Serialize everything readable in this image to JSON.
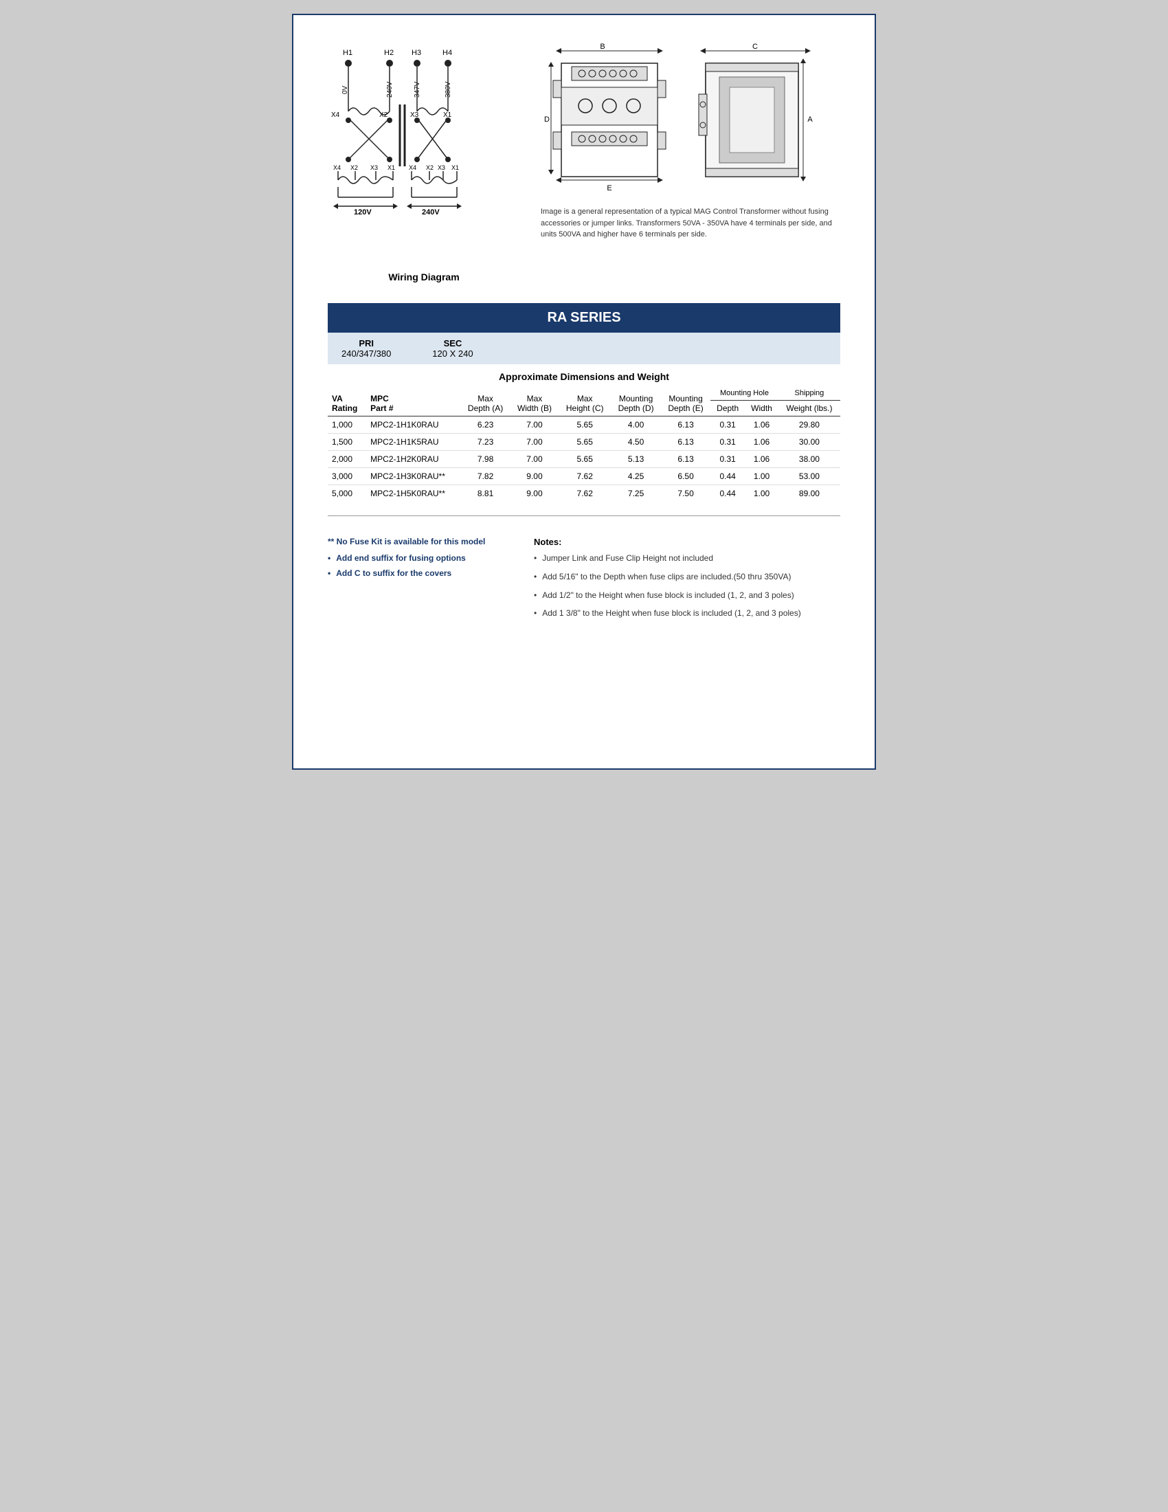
{
  "wiring": {
    "label": "Wiring Diagram",
    "terminals_h": [
      "H1",
      "H2",
      "H3",
      "H4"
    ],
    "voltages_h": [
      "0V",
      "240V",
      "347V",
      "380V"
    ],
    "terminals_x": [
      "X4",
      "X2",
      "X3",
      "X1"
    ],
    "secondary_voltages": [
      "120V",
      "240V"
    ]
  },
  "transformer": {
    "caption": "Image is a general representation of a typical MAG Control Transformer without fusing accessories or jumper links.  Transformers 50VA - 350VA  have 4 terminals per side, and units 500VA and higher have 6 terminals per side."
  },
  "series": {
    "title": "RA SERIES",
    "pri_label": "PRI",
    "pri_value": "240/347/380",
    "sec_label": "SEC",
    "sec_value": "120 X 240",
    "dimensions_title": "Approximate Dimensions and Weight",
    "col_headers": {
      "va_rating": "VA\nRating",
      "mpc_part": "MPC\nPart #",
      "max_depth": "Max\nDepth (A)",
      "max_width": "Max\nWidth (B)",
      "max_height": "Max\nHeight (C)",
      "mounting_depth_d": "Mounting\nDepth (D)",
      "mounting_depth_e": "Mounting\nDepth (E)",
      "mh_depth": "Depth",
      "mh_width": "Width",
      "shipping_weight": "Weight (lbs.)",
      "mounting_hole_group": "Mounting Hole",
      "shipping_group": "Shipping"
    },
    "rows": [
      {
        "va": "1,000",
        "part": "MPC2-1H1K0RAU",
        "depth_a": "6.23",
        "width_b": "7.00",
        "height_c": "5.65",
        "mount_d": "4.00",
        "mount_e": "6.13",
        "mh_depth": "0.31",
        "mh_width": "1.06",
        "ship_wt": "29.80"
      },
      {
        "va": "1,500",
        "part": "MPC2-1H1K5RAU",
        "depth_a": "7.23",
        "width_b": "7.00",
        "height_c": "5.65",
        "mount_d": "4.50",
        "mount_e": "6.13",
        "mh_depth": "0.31",
        "mh_width": "1.06",
        "ship_wt": "30.00"
      },
      {
        "va": "2,000",
        "part": "MPC2-1H2K0RAU",
        "depth_a": "7.98",
        "width_b": "7.00",
        "height_c": "5.65",
        "mount_d": "5.13",
        "mount_e": "6.13",
        "mh_depth": "0.31",
        "mh_width": "1.06",
        "ship_wt": "38.00"
      },
      {
        "va": "3,000",
        "part": "MPC2-1H3K0RAU**",
        "depth_a": "7.82",
        "width_b": "9.00",
        "height_c": "7.62",
        "mount_d": "4.25",
        "mount_e": "6.50",
        "mh_depth": "0.44",
        "mh_width": "1.00",
        "ship_wt": "53.00"
      },
      {
        "va": "5,000",
        "part": "MPC2-1H5K0RAU**",
        "depth_a": "8.81",
        "width_b": "9.00",
        "height_c": "7.62",
        "mount_d": "7.25",
        "mount_e": "7.50",
        "mh_depth": "0.44",
        "mh_width": "1.00",
        "ship_wt": "89.00"
      }
    ]
  },
  "notes_left": {
    "no_fuse_text": "** No Fuse Kit is available for this model",
    "bullets": [
      "Add end suffix for fusing options",
      "Add C to suffix for the covers"
    ]
  },
  "notes_right": {
    "title": "Notes:",
    "bullets": [
      "Jumper Link and Fuse Clip Height not included",
      "Add 5/16\" to the Depth when fuse clips are included.(50 thru 350VA)",
      "Add 1/2\" to the Height when fuse block is included (1, 2, and 3 poles)",
      "Add 1 3/8\" to the Height when fuse block is included (1, 2, and 3 poles)"
    ]
  }
}
